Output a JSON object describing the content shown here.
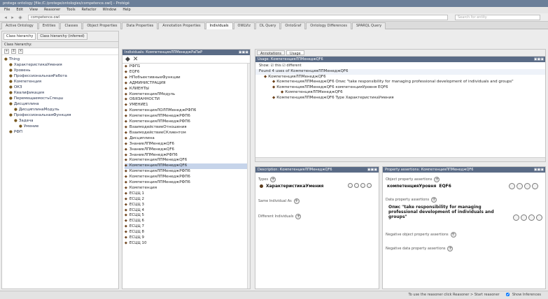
{
  "window": {
    "title": "protege ontology  [file:/C:/protege/ontologies/competence.owl]  –  Protégé"
  },
  "menu": [
    "File",
    "Edit",
    "View",
    "Reasoner",
    "Tools",
    "Refactor",
    "Window",
    "Help"
  ],
  "address": {
    "url": "competence.owl",
    "search_placeholder": "Search for entity"
  },
  "tabs": [
    {
      "label": "Active Ontology",
      "active": false
    },
    {
      "label": "Entities",
      "active": false
    },
    {
      "label": "Classes",
      "active": false
    },
    {
      "label": "Object Properties",
      "active": false
    },
    {
      "label": "Data Properties",
      "active": false
    },
    {
      "label": "Annotation Properties",
      "active": false
    },
    {
      "label": "Individuals",
      "active": true
    },
    {
      "label": "OWLViz",
      "active": false
    },
    {
      "label": "DL Query",
      "active": false
    },
    {
      "label": "OntoGraf",
      "active": false
    },
    {
      "label": "Ontology Differences",
      "active": false
    },
    {
      "label": "SPARQL Query",
      "active": false
    }
  ],
  "left": {
    "subtabs": [
      "Class hierarchy",
      "Class hierarchy (inferred)"
    ],
    "header": "Class hierarchy:",
    "tree": [
      {
        "label": "Thing",
        "indent": 0
      },
      {
        "label": "ХарактеристикаУмения",
        "indent": 1
      },
      {
        "label": "Уровень",
        "indent": 1
      },
      {
        "label": "ПрофессиональнаяРабота",
        "indent": 1
      },
      {
        "label": "Компетенция",
        "indent": 1
      },
      {
        "label": "ОКЗ",
        "indent": 1
      },
      {
        "label": "Квалификация",
        "indent": 1
      },
      {
        "label": "ПеремещаемостьСпецш",
        "indent": 1
      },
      {
        "label": "Дисциплина",
        "indent": 1
      },
      {
        "label": "ДисциплинаМодуль",
        "indent": 2
      },
      {
        "label": "ПрофессиональнаяФункция",
        "indent": 1
      },
      {
        "label": "Задача",
        "indent": 2
      },
      {
        "label": "Умение",
        "indent": 3
      },
      {
        "label": "РФП",
        "indent": 1
      }
    ]
  },
  "middle": {
    "header": "Individuals: КомпетенцияЛПМенеджРаПиР",
    "tools": [
      "◆",
      "✕"
    ],
    "items": [
      "РФП1",
      "EQF6",
      "НПобъективныеФункции",
      "АДМИНИСТРАЦИЯ",
      "КЛИЕНТЫ",
      "КомпетенцияЛМодуль",
      "ОБЯЗАННОСТИ",
      "УМЕНИЕ1",
      "КомпетенцияЛОЛПМенеджРФП6",
      "КомпетенцияЛПМенеджРФП6",
      "КомпетенцияЛПМенеджРФП6",
      "ВзаимодействиеОтношения",
      "ВзаимодействиеСКлиентом",
      "Дисциплина",
      "ЗнаниеЛПМенеджQF6",
      "ЗнаниеЛПМенеджQF6",
      "ЗнаниеЛПМенеджРФП6",
      "КомпетенцияЛПМенеджQF6",
      "КомпетенцияЛПМенеджQF6",
      "КомпетенцияЛПМенеджРФП6",
      "КомпетенцияЛПМенеджРФП6",
      "КомпетенцияЛПМенеджРФП6",
      "Компетенция",
      "ЕСЦЦ 1",
      "ЕСЦЦ 2",
      "ЕСЦЦ 3",
      "ЕСЦЦ 4",
      "ЕСЦЦ 5",
      "ЕСЦЦ 6",
      "ЕСЦЦ 7",
      "ЕСЦЦ 8",
      "ЕСЦЦ 9",
      "ЕСЦЦ 10"
    ],
    "selected_index": 18
  },
  "usage": {
    "tabs": [
      "Annotations",
      "Usage"
    ],
    "header": "Usage: КомпетенцияЛПМенеджQF6",
    "show_label": "Show:  ☑ this   ☑ different",
    "found": "Found 4 uses of КомпетенцияЛПМенеджQF6",
    "lines": [
      {
        "text": "КомпетенцияЛПМенеджQF6",
        "indent": 1
      },
      {
        "text": "КомпетенцияЛПМенеджQF6 Опис \"take responsibility for managing professional development of individuals and groups\"",
        "indent": 2
      },
      {
        "text": "КомпетенцияЛПМенеджQF6 компетенцияУровня EQF6",
        "indent": 2
      },
      {
        "text": "КомпетенцияЛПМенеджQF6",
        "indent": 3
      },
      {
        "text": "КомпетенцияЛПМенеджQF6 Type ХарактеристикаУмения",
        "indent": 2
      }
    ]
  },
  "annotations": {
    "header": "Description: КомпетенцияЛПМенеджQF6",
    "types_label": "Types",
    "type_value": "ХарактеристикаУмения",
    "same_as_label": "Same Individual As",
    "different_label": "Different Individuals"
  },
  "description": {
    "header": "Property assertions: КомпетенцияЛПМенеджQF6",
    "obj_label": "Object property assertions",
    "obj_prop": "компетенцияУровня",
    "obj_val": "EQF6",
    "data_label": "Data property assertions",
    "data_prop": "Опис",
    "data_val": "\"take responsibility for managing professional development of individuals and groups\"",
    "neg_obj_label": "Negative object property assertions",
    "neg_data_label": "Negative data property assertions"
  },
  "status": {
    "text": "To use the reasoner click Reasoner > Start reasoner",
    "checkbox": "Show Inferences"
  }
}
